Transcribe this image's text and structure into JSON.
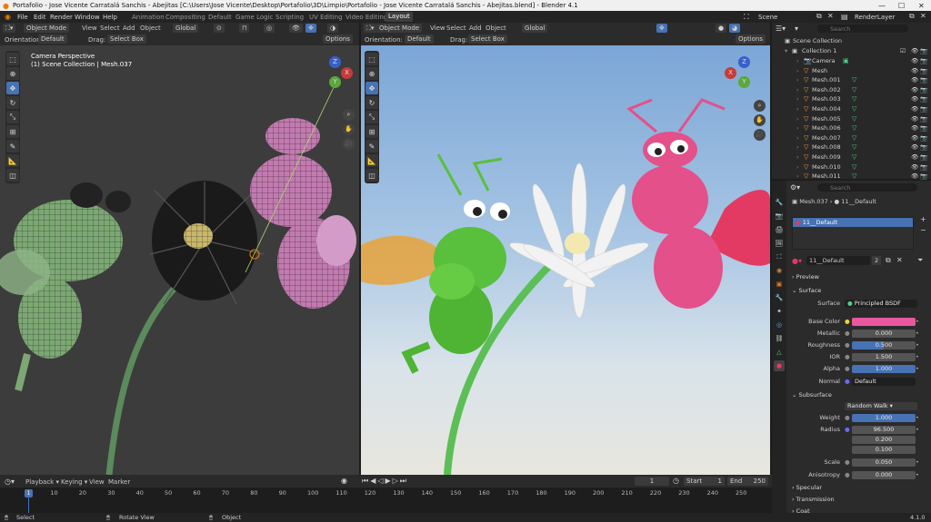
{
  "title": "Portafolio - Jose Vicente Carratalá Sanchis - Abejitas [C:\\Users\\Jose Vicente\\Desktop\\Portafolio\\3D\\Limpio\\Portafolio - Jose Vicente Carratalá Sanchis - Abejitas.blend] - Blender 4.1",
  "menu": [
    "File",
    "Edit",
    "Render",
    "Window",
    "Help"
  ],
  "workspaces": [
    "Animation",
    "Compositing",
    "Default",
    "Game Logic",
    "Scripting",
    "UV Editing",
    "Video Editing",
    "Layout"
  ],
  "scene": "Scene",
  "render_layer": "RenderLayer",
  "left_view": {
    "mode": "Object Mode",
    "view": "View",
    "select": "Select",
    "add": "Add",
    "object": "Object",
    "orientation_label": "Orientation:",
    "orientation": "Default",
    "drag_label": "Drag:",
    "drag": "Select Box",
    "transform": "Global",
    "options": "Options",
    "perspective": "Camera Perspective",
    "collection": "(1) Scene Collection | Mesh.037"
  },
  "right_view": {
    "mode": "Object Mode",
    "view": "View",
    "select": "Select",
    "add": "Add",
    "object": "Object",
    "orientation_label": "Orientation:",
    "orientation": "Default",
    "drag_label": "Drag:",
    "drag": "Select Box",
    "transform": "Global",
    "options": "Options"
  },
  "outliner": {
    "search_placeholder": "Search",
    "root": "Scene Collection",
    "collection": "Collection 1",
    "items": [
      "Camera",
      "Mesh",
      "Mesh.001",
      "Mesh.002",
      "Mesh.003",
      "Mesh.004",
      "Mesh.005",
      "Mesh.006",
      "Mesh.007",
      "Mesh.008",
      "Mesh.009",
      "Mesh.010",
      "Mesh.011"
    ]
  },
  "properties": {
    "search_placeholder": "Search",
    "object": "Mesh.037",
    "material_header": "11__Default",
    "slot": "11__Default",
    "material": "11__Default",
    "users": "2",
    "preview": "Preview",
    "surface": "Surface",
    "surface_label": "Surface",
    "surface_value": "Principled BSDF",
    "base_color_label": "Base Color",
    "base_color": "#e8589e",
    "metallic_label": "Metallic",
    "metallic": "0.000",
    "roughness_label": "Roughness",
    "roughness": "0.500",
    "ior_label": "IOR",
    "ior": "1.500",
    "alpha_label": "Alpha",
    "alpha": "1.000",
    "normal_label": "Normal",
    "normal": "Default",
    "subsurface": "Subsurface",
    "subsurface_method": "Random Walk",
    "weight_label": "Weight",
    "weight": "1.000",
    "radius_label": "Radius",
    "radius": [
      "96.500",
      "0.200",
      "0.100"
    ],
    "scale_label": "Scale",
    "scale": "0.050",
    "anisotropy_label": "Anisotropy",
    "anisotropy": "0.000",
    "specular": "Specular",
    "transmission": "Transmission",
    "coat": "Coat"
  },
  "timeline": {
    "playback": "Playback",
    "keying": "Keying",
    "view": "View",
    "marker": "Marker",
    "current": "1",
    "start_label": "Start",
    "start": "1",
    "end_label": "End",
    "end": "250",
    "ticks": [
      "1",
      "10",
      "20",
      "30",
      "40",
      "50",
      "60",
      "70",
      "80",
      "90",
      "100",
      "110",
      "120",
      "130",
      "140",
      "150",
      "160",
      "170",
      "180",
      "190",
      "200",
      "210",
      "220",
      "230",
      "240",
      "250"
    ]
  },
  "status": {
    "select": "Select",
    "rotate": "Rotate View",
    "object": "Object",
    "version": "4.1.0"
  },
  "colors": {
    "accent": "#4772b3",
    "orange": "#ff9a3c",
    "green": "#4cd28a"
  }
}
